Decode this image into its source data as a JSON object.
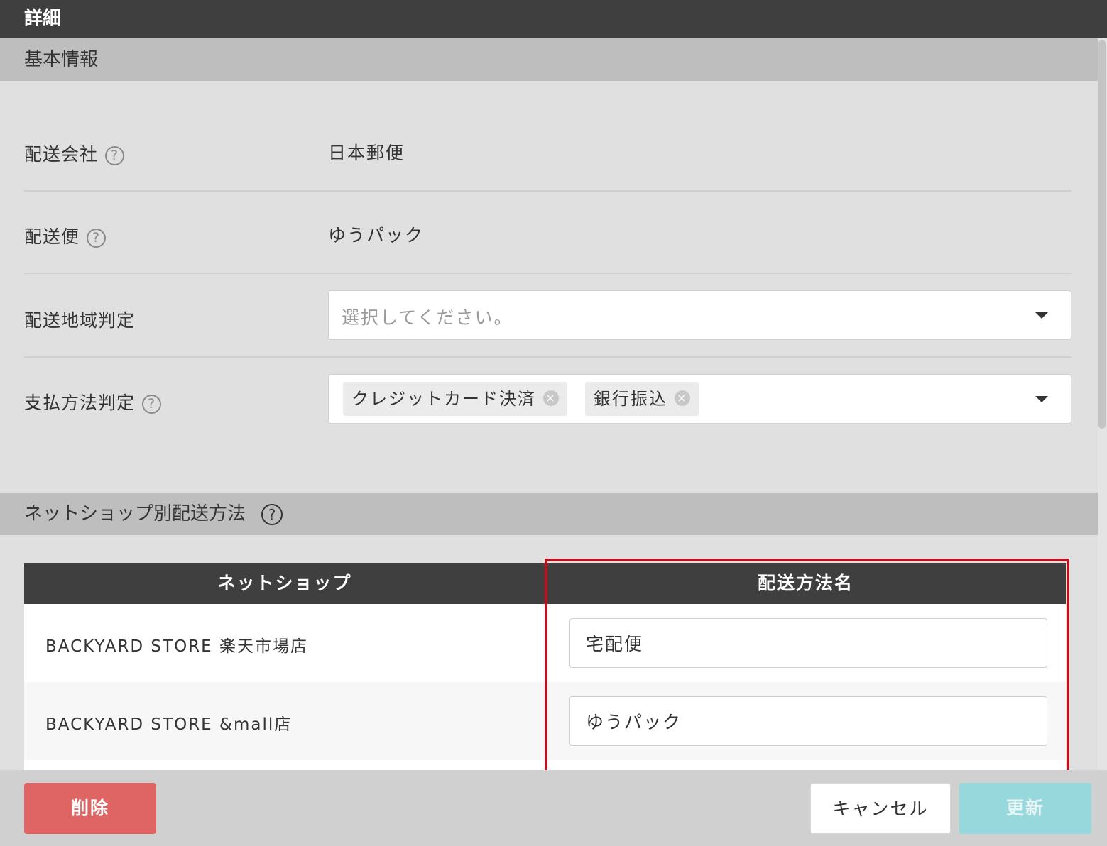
{
  "window": {
    "title": "詳細"
  },
  "basic_info": {
    "header": "基本情報",
    "fields": {
      "carrier": {
        "label": "配送会社",
        "value": "日本郵便"
      },
      "service": {
        "label": "配送便",
        "value": "ゆうパック"
      },
      "region": {
        "label": "配送地域判定",
        "placeholder": "選択してください。"
      },
      "payment": {
        "label": "支払方法判定",
        "tags": [
          "クレジットカード決済",
          "銀行振込"
        ]
      }
    }
  },
  "shop_methods": {
    "header": "ネットショップ別配送方法",
    "columns": [
      "ネットショップ",
      "配送方法名"
    ],
    "rows": [
      {
        "shop": "BACKYARD STORE 楽天市場店",
        "method": "宅配便"
      },
      {
        "shop": "BACKYARD STORE &mall店",
        "method": "ゆうパック"
      }
    ]
  },
  "footer": {
    "delete_label": "削除",
    "cancel_label": "キャンセル",
    "update_label": "更新"
  },
  "icons": {
    "help": "question-circle-icon",
    "dropdown": "caret-down-icon",
    "tag_remove": "close-circle-icon"
  },
  "colors": {
    "header_dark": "#3f3f3f",
    "section_header": "#bebebe",
    "delete": "#df6464",
    "update_disabled": "#97d8dc",
    "highlight_border": "#b8141f"
  }
}
